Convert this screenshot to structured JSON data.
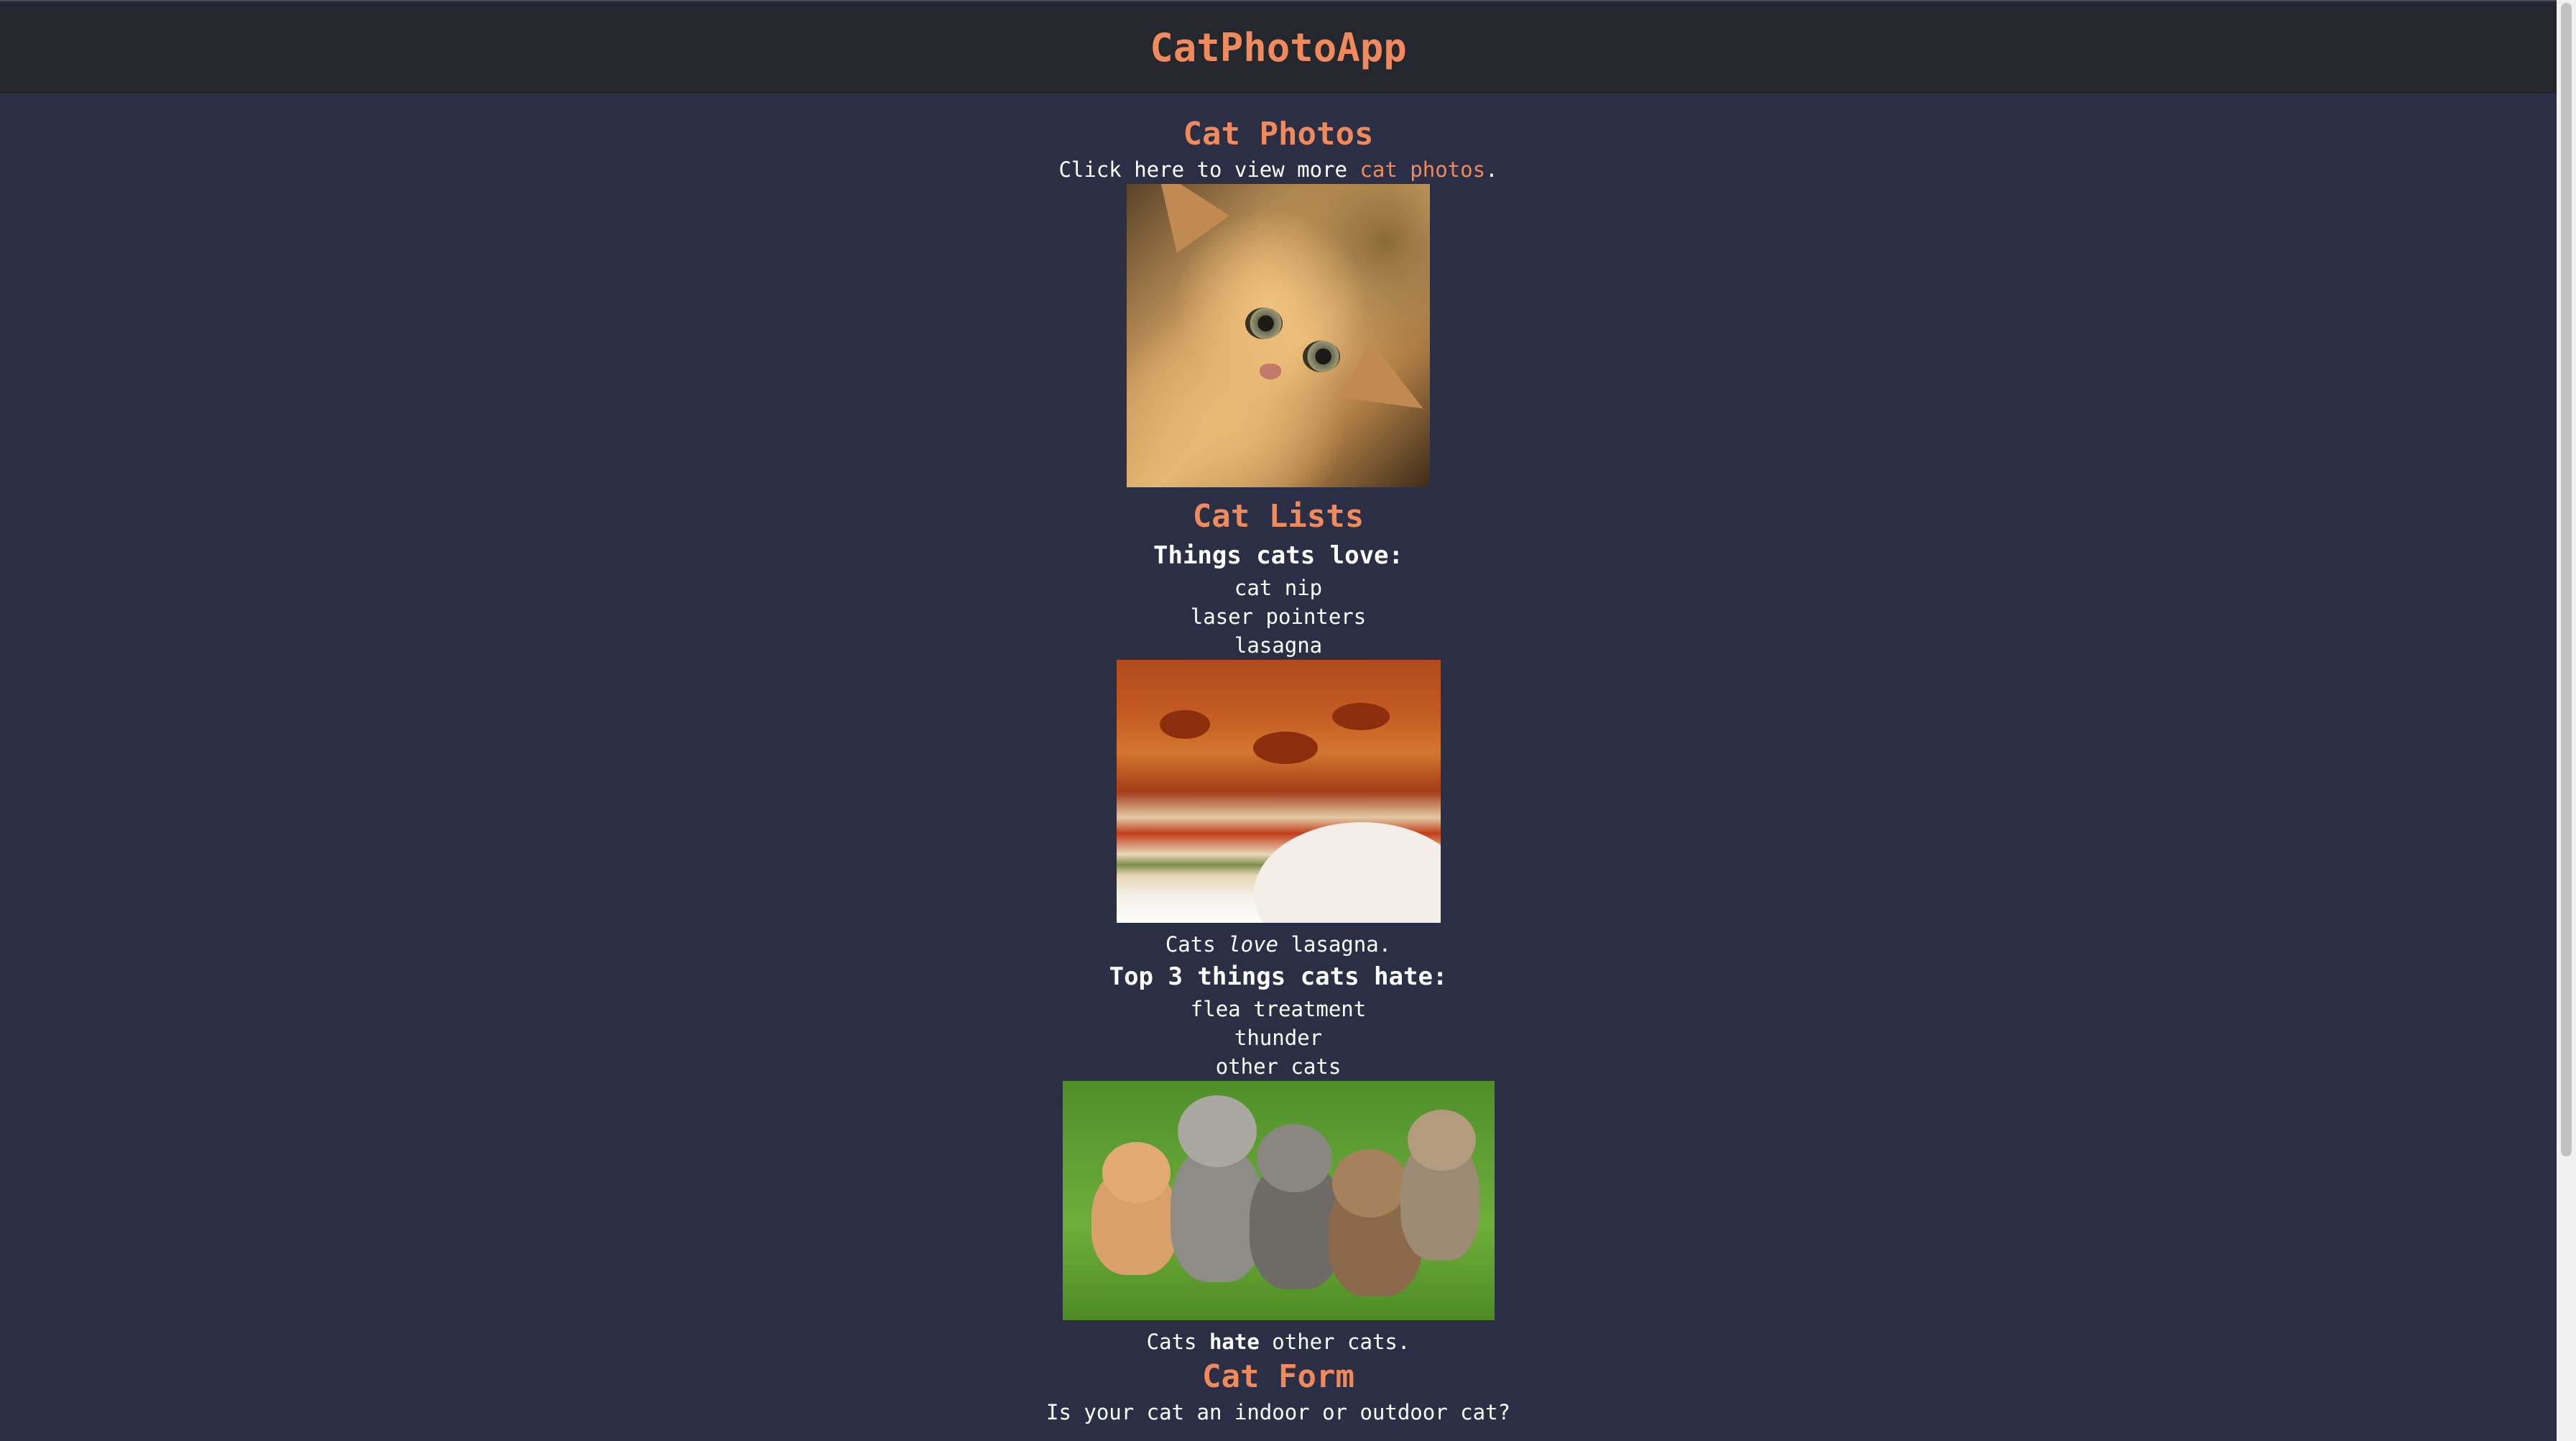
{
  "header": {
    "title": "CatPhotoApp"
  },
  "sections": {
    "photos": {
      "heading": "Cat Photos",
      "text_before": "Click here to view more ",
      "link_text": "cat photos",
      "text_after": "."
    },
    "lists": {
      "heading": "Cat Lists",
      "loves_heading": "Things cats love:",
      "loves": [
        "cat nip",
        "laser pointers",
        "lasagna"
      ],
      "loves_caption_before": "Cats ",
      "loves_caption_em": "love",
      "loves_caption_after": " lasagna.",
      "hates_heading": "Top 3 things cats hate:",
      "hates": [
        "flea treatment",
        "thunder",
        "other cats"
      ],
      "hates_caption_before": "Cats ",
      "hates_caption_strong": "hate",
      "hates_caption_after": " other cats."
    },
    "form": {
      "heading": "Cat Form",
      "question": "Is your cat an indoor or outdoor cat?"
    }
  },
  "colors": {
    "background": "#2b2f45",
    "header_background": "#25272f",
    "accent": "#f08a5d",
    "text": "#ffffff"
  }
}
